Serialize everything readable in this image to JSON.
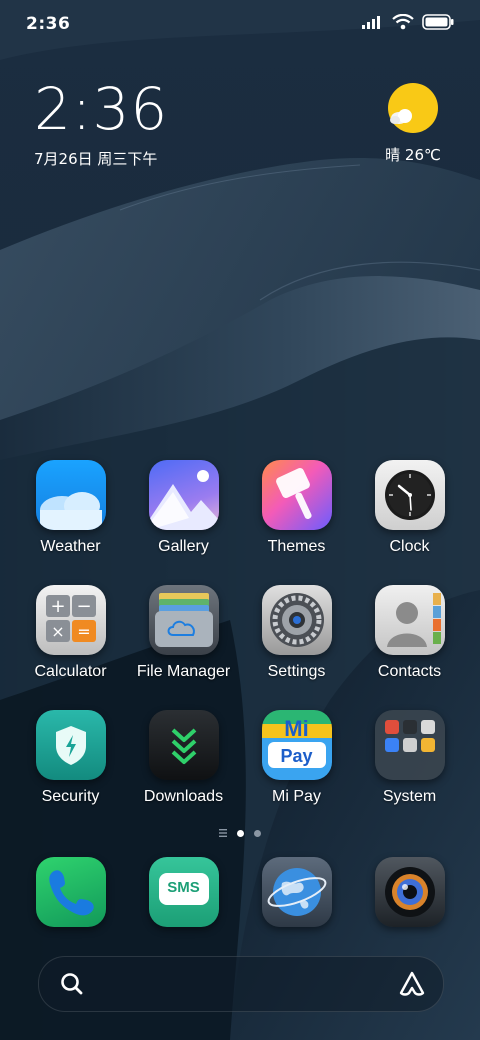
{
  "status_bar": {
    "time": "2:36",
    "icons": [
      "signal-icon",
      "wifi-icon",
      "battery-icon"
    ]
  },
  "clock_widget": {
    "time": "2:36",
    "date": "7月26日 周三下午"
  },
  "weather_widget": {
    "icon": "sun-cloud-icon",
    "text": "晴 26℃"
  },
  "apps": [
    {
      "label": "Weather",
      "icon": "weather-icon"
    },
    {
      "label": "Gallery",
      "icon": "gallery-icon"
    },
    {
      "label": "Themes",
      "icon": "themes-icon"
    },
    {
      "label": "Clock",
      "icon": "clock-icon"
    },
    {
      "label": "Calculator",
      "icon": "calculator-icon"
    },
    {
      "label": "File Manager",
      "icon": "file-manager-icon"
    },
    {
      "label": "Settings",
      "icon": "settings-icon"
    },
    {
      "label": "Contacts",
      "icon": "contacts-icon"
    },
    {
      "label": "Security",
      "icon": "security-icon"
    },
    {
      "label": "Downloads",
      "icon": "downloads-icon"
    },
    {
      "label": "Mi Pay",
      "icon": "mi-pay-icon",
      "icon_text": [
        "Mi",
        "Pay"
      ]
    },
    {
      "label": "System",
      "icon": "system-folder-icon"
    }
  ],
  "page_indicator": {
    "pages": 2,
    "current": 1,
    "has_list_marker": true
  },
  "dock": [
    {
      "name": "phone",
      "icon": "phone-icon"
    },
    {
      "name": "sms",
      "icon": "sms-icon",
      "icon_text": "SMS"
    },
    {
      "name": "browser",
      "icon": "globe-icon"
    },
    {
      "name": "camera",
      "icon": "camera-icon"
    }
  ],
  "search_bar": {
    "left_icon": "search-icon",
    "right_icon": "assistant-icon"
  },
  "colors": {
    "weather_blue": "#1e9bf0",
    "security_teal": "#1aa497",
    "sms_green": "#25b58a",
    "sun_yellow": "#f9c916"
  }
}
